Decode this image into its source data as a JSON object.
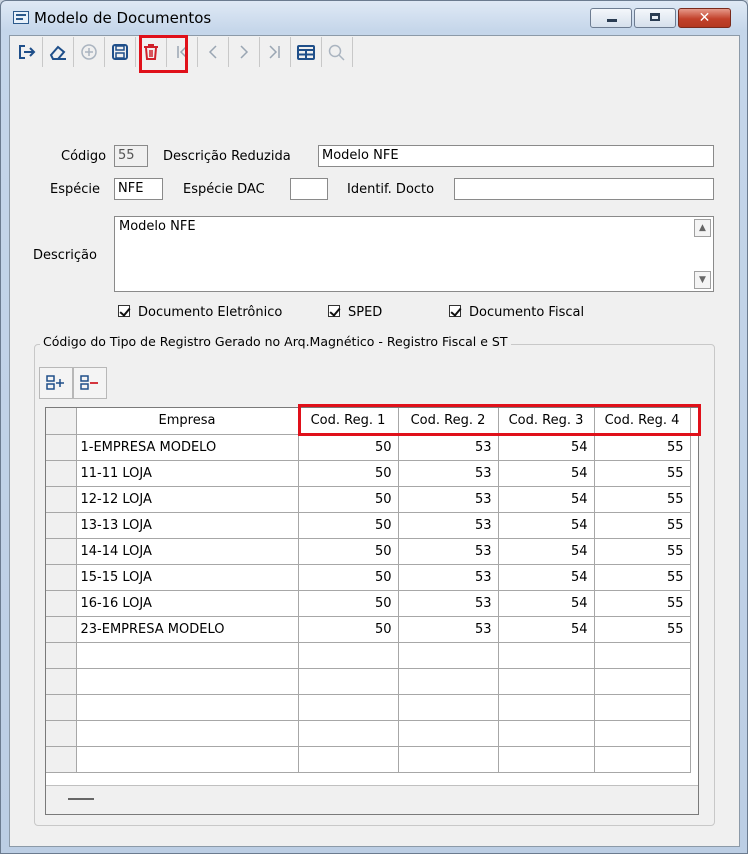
{
  "window": {
    "title": "Modelo de Documentos"
  },
  "toolbar": {
    "buttons": [
      {
        "icon": "exit-icon",
        "enabled": true
      },
      {
        "icon": "eraser-icon",
        "enabled": true
      },
      {
        "icon": "add-circle-icon",
        "enabled": false
      },
      {
        "icon": "save-icon",
        "enabled": true,
        "highlighted": true
      },
      {
        "icon": "trash-icon",
        "enabled": true
      },
      {
        "icon": "first-record-icon",
        "enabled": false
      },
      {
        "icon": "previous-record-icon",
        "enabled": false
      },
      {
        "icon": "next-record-icon",
        "enabled": false
      },
      {
        "icon": "last-record-icon",
        "enabled": false
      },
      {
        "icon": "grid-view-icon",
        "enabled": true
      },
      {
        "icon": "search-icon",
        "enabled": false
      }
    ]
  },
  "form": {
    "codigo_label": "Código",
    "codigo_value": "55",
    "descricao_reduzida_label": "Descrição Reduzida",
    "descricao_reduzida_value": "Modelo NFE",
    "especie_label": "Espécie",
    "especie_value": "NFE",
    "especie_dac_label": "Espécie DAC",
    "especie_dac_value": "",
    "identif_docto_label": "Identif. Docto",
    "identif_docto_value": "",
    "descricao_label": "Descrição",
    "descricao_value": "Modelo NFE"
  },
  "checkboxes": {
    "documento_eletronico": {
      "label": "Documento Eletrônico",
      "checked": true
    },
    "sped": {
      "label": "SPED",
      "checked": true
    },
    "documento_fiscal": {
      "label": "Documento Fiscal",
      "checked": true
    }
  },
  "group": {
    "title": "Código do Tipo de Registro Gerado no Arq.Magnético - Registro Fiscal e ST",
    "add_row_icon": "add-row-icon",
    "remove_row_icon": "remove-row-icon"
  },
  "grid": {
    "columns": [
      "Empresa",
      "Cod. Reg. 1",
      "Cod. Reg. 2",
      "Cod. Reg. 3",
      "Cod. Reg. 4"
    ],
    "rows": [
      [
        "1-EMPRESA MODELO",
        "50",
        "53",
        "54",
        "55"
      ],
      [
        "11-11 LOJA",
        "50",
        "53",
        "54",
        "55"
      ],
      [
        "12-12 LOJA",
        "50",
        "53",
        "54",
        "55"
      ],
      [
        "13-13 LOJA",
        "50",
        "53",
        "54",
        "55"
      ],
      [
        "14-14 LOJA",
        "50",
        "53",
        "54",
        "55"
      ],
      [
        "15-15 LOJA",
        "50",
        "53",
        "54",
        "55"
      ],
      [
        "16-16 LOJA",
        "50",
        "53",
        "54",
        "55"
      ],
      [
        "23-EMPRESA MODELO",
        "50",
        "53",
        "54",
        "55"
      ]
    ],
    "empty_rows": 5
  },
  "colors": {
    "highlight": "#e0101a",
    "delete_red": "#d0202a",
    "icon_blue": "#1f4f8a"
  }
}
